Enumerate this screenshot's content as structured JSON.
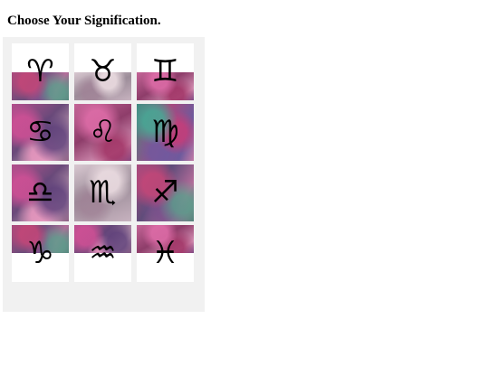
{
  "page": {
    "title": "Choose Your Signification."
  },
  "signs": [
    {
      "name": "aries",
      "glyph": "♈",
      "texture": "t-c",
      "art": "band"
    },
    {
      "name": "taurus",
      "glyph": "♉",
      "texture": "t-b",
      "art": "band"
    },
    {
      "name": "gemini",
      "glyph": "♊",
      "texture": "t-d",
      "art": "band"
    },
    {
      "name": "cancer",
      "glyph": "♋",
      "texture": "t-a",
      "art": "full"
    },
    {
      "name": "leo",
      "glyph": "♌",
      "texture": "t-d",
      "art": "full"
    },
    {
      "name": "virgo",
      "glyph": "♍",
      "texture": "t-e",
      "art": "full"
    },
    {
      "name": "libra",
      "glyph": "♎",
      "texture": "t-a",
      "art": "full"
    },
    {
      "name": "scorpio",
      "glyph": "♏",
      "texture": "t-b",
      "art": "full"
    },
    {
      "name": "sagittarius",
      "glyph": "♐",
      "texture": "t-c",
      "art": "full"
    },
    {
      "name": "capricorn",
      "glyph": "♑",
      "texture": "t-c",
      "art": "band-top"
    },
    {
      "name": "aquarius",
      "glyph": "♒",
      "texture": "t-a",
      "art": "band-top"
    },
    {
      "name": "pisces",
      "glyph": "♓",
      "texture": "t-d",
      "art": "band-top"
    }
  ]
}
